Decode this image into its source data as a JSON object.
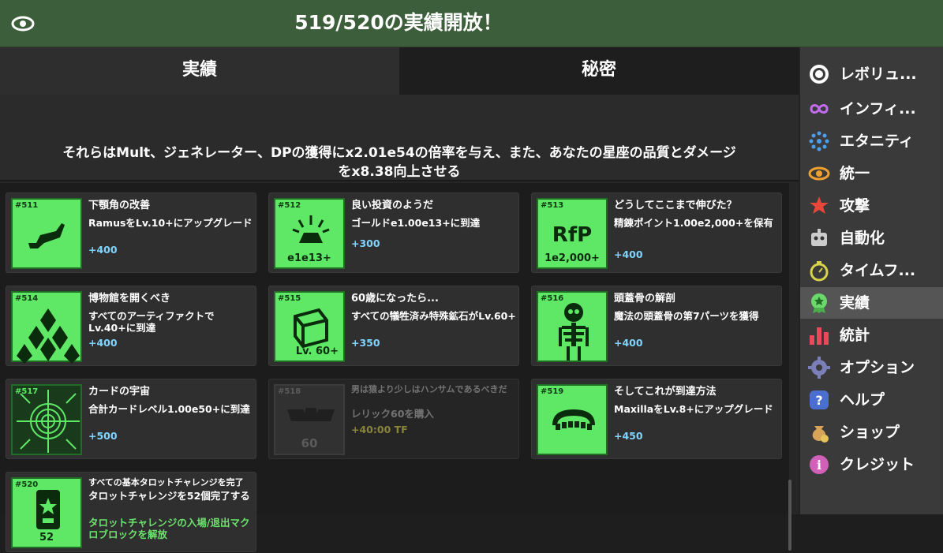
{
  "header": {
    "title": "519/520の実績開放！"
  },
  "tabs": [
    {
      "label": "実績"
    },
    {
      "label": "秘密"
    }
  ],
  "description": {
    "line1": "それらはMult、ジェネレーター、DPの獲得にx2.01e54の倍率を与え、また、あなたの星座の品質とダメージ",
    "line2": "をx8.38向上させる"
  },
  "cards": [
    {
      "num": "#511",
      "title": "下顎角の改善",
      "desc": "RamusをLv.10+にアップグレード",
      "reward": "+400",
      "icon": "jaw-icon",
      "icon_label": ""
    },
    {
      "num": "#512",
      "title": "良い投資のようだ",
      "desc": "ゴールドe1.00e13+に到達",
      "reward": "+300",
      "icon": "gold-bar-icon",
      "icon_label": "e1e13+"
    },
    {
      "num": "#513",
      "title": "どうしてここまで伸びた？",
      "desc": "精錬ポイント1.00e2,000+を保有",
      "reward": "+400",
      "icon": "rfp-icon",
      "icon_big": "RfP",
      "icon_label": "1e2,000+"
    },
    {
      "num": "#514",
      "title": "博物館を開くべき",
      "desc": "すべてのアーティファクトでLv.40+に到達",
      "reward": "+400",
      "icon": "pyramid-icon",
      "icon_label": ""
    },
    {
      "num": "#515",
      "title": "60歳になったら...",
      "desc": "すべての犠牲済み特殊鉱石がLv.60+",
      "reward": "+350",
      "icon": "ore-cube-icon",
      "icon_label": "Lv. 60+"
    },
    {
      "num": "#516",
      "title": "頭蓋骨の解剖",
      "desc": "魔法の頭蓋骨の第7パーツを獲得",
      "reward": "+400",
      "icon": "skeleton-icon",
      "icon_label": ""
    },
    {
      "num": "#517",
      "title": "カードの宇宙",
      "desc": "合計カードレベル1.00e50+に到達",
      "reward": "+500",
      "icon": "card-universe-icon",
      "icon_label": ""
    },
    {
      "num": "#518",
      "title": "男は猿より少しはハンサムであるべきだ",
      "desc": "レリック60を購入",
      "reward": "+40:00 TF",
      "icon": "relic-icon",
      "icon_label": "60"
    },
    {
      "num": "#519",
      "title": "そしてこれが到達方法",
      "desc": "MaxillaをLv.8+にアップグレード",
      "reward": "+450",
      "icon": "maxilla-icon",
      "icon_label": ""
    },
    {
      "num": "#520",
      "title": "すべての基本タロットチャレンジを完了",
      "desc": "タロットチャレンジを52個完了する",
      "reward": "タロットチャレンジの入場/退出マクロブロックを解放",
      "icon": "tarot-icon",
      "icon_label": "52"
    }
  ],
  "sidebar": {
    "items": [
      {
        "label": "レボリュ...",
        "icon": "target-icon"
      },
      {
        "label": "インフィ...",
        "icon": "infinity-icon"
      },
      {
        "label": "エタニティ",
        "icon": "dots-ring-icon"
      },
      {
        "label": "統一",
        "icon": "swirl-icon"
      },
      {
        "label": "攻撃",
        "icon": "attack-icon"
      },
      {
        "label": "自動化",
        "icon": "robot-icon"
      },
      {
        "label": "タイムフ...",
        "icon": "stopwatch-icon"
      },
      {
        "label": "実績",
        "icon": "medal-icon"
      },
      {
        "label": "統計",
        "icon": "bar-chart-icon"
      },
      {
        "label": "オプション",
        "icon": "gear-icon"
      },
      {
        "label": "ヘルプ",
        "icon": "question-icon"
      },
      {
        "label": "ショップ",
        "icon": "money-bag-icon"
      },
      {
        "label": "クレジット",
        "icon": "info-icon"
      }
    ],
    "active": "実績"
  },
  "colors": {
    "header_bg": "#3d5e3a",
    "card_icon_bg": "#5ee866",
    "reward": "#7fd4ff",
    "locked_reward": "#b6b04a"
  }
}
